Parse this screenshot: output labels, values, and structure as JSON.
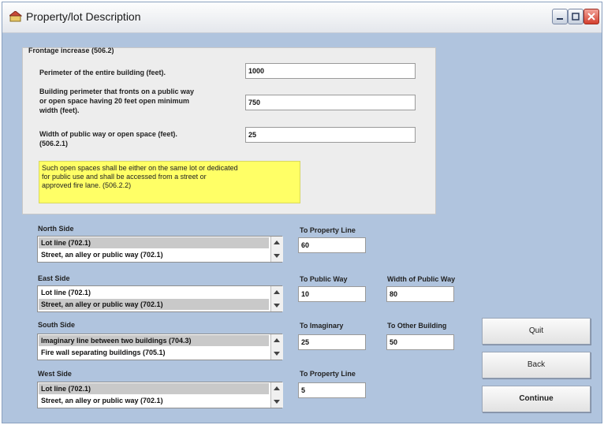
{
  "window": {
    "title": "Property/lot Description"
  },
  "frontage": {
    "group_label": "Frontage increase (506.2)",
    "perimeter": {
      "label": "Perimeter of the entire building (feet).",
      "value": "1000"
    },
    "fronting": {
      "label_lines": [
        "Building perimeter that fronts on a public way",
        "or open space having 20 feet open minimum",
        "width (feet)."
      ],
      "value": "750"
    },
    "width": {
      "label_lines": [
        "Width of public way or open space (feet).",
        "(506.2.1)"
      ],
      "value": "25"
    },
    "note_lines": [
      "Such open spaces shall be either on the same lot or dedicated",
      "for public use and shall be accessed from a street or",
      "approved fire lane. (506.2.2)"
    ]
  },
  "sides": {
    "north": {
      "label": "North Side",
      "items": [
        "Lot line (702.1)",
        "Street, an alley or public way (702.1)"
      ],
      "selected": 0,
      "field1": {
        "label": "To Property Line",
        "value": "60"
      }
    },
    "east": {
      "label": "East Side",
      "items": [
        "Lot line (702.1)",
        "Street, an alley or public way (702.1)"
      ],
      "selected": 1,
      "field1": {
        "label": "To Public Way",
        "value": "10"
      },
      "field2": {
        "label": "Width of Public Way",
        "value": "80"
      }
    },
    "south": {
      "label": "South Side",
      "items": [
        "Imaginary line between two buildings (704.3)",
        "Fire wall separating buildings (705.1)"
      ],
      "selected": 0,
      "field1": {
        "label": "To Imaginary",
        "value": "25"
      },
      "field2": {
        "label": "To Other Building",
        "value": "50"
      }
    },
    "west": {
      "label": "West Side",
      "items": [
        "Lot line (702.1)",
        "Street, an alley or public way (702.1)"
      ],
      "selected": 0,
      "field1": {
        "label": "To Property Line",
        "value": "5"
      }
    }
  },
  "buttons": {
    "quit": "Quit",
    "back": "Back",
    "continue": "Continue"
  }
}
